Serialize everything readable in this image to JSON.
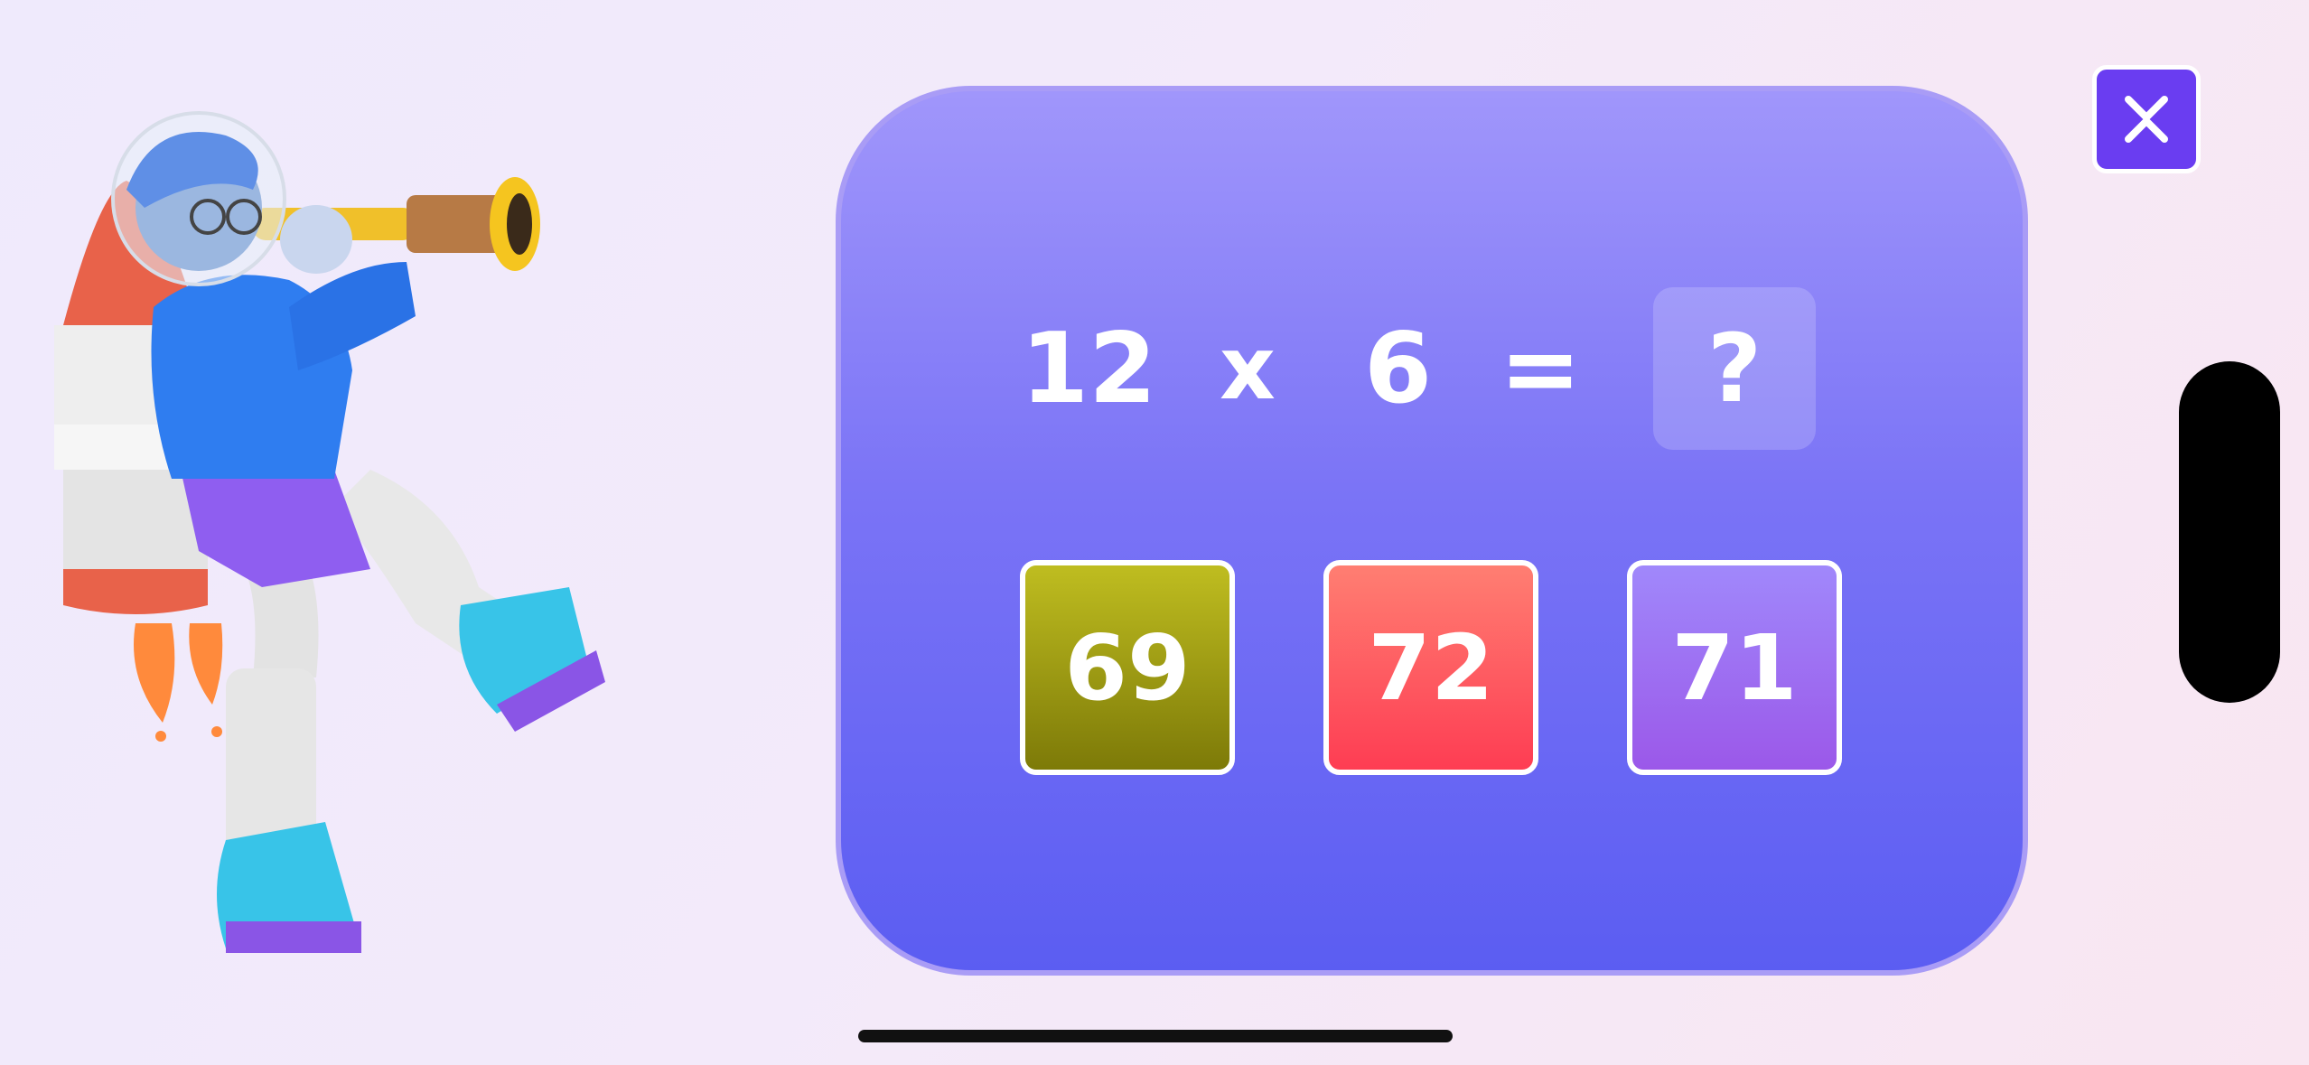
{
  "equation": {
    "operand_a": "12",
    "operator": "x",
    "operand_b": "6",
    "equals": "=",
    "answer_placeholder": "?"
  },
  "options": [
    {
      "label": "69",
      "color": "#9e9b13"
    },
    {
      "label": "72",
      "color": "#ff5a62"
    },
    {
      "label": "71",
      "color": "#9d6ff2"
    }
  ],
  "close_button": {
    "icon": "close-icon",
    "color": "#6a3df1"
  },
  "colors": {
    "card_top": "#a096fb",
    "card_bottom": "#5b5df2",
    "card_border": "#a99cf6"
  }
}
